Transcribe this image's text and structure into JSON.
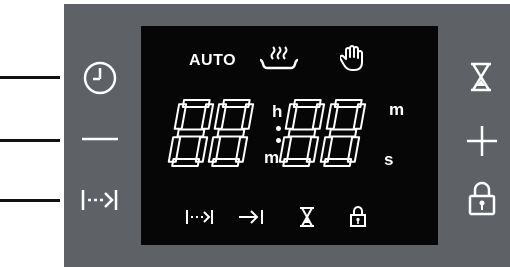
{
  "callout_lines": [
    "clock",
    "minus",
    "cooking-time"
  ],
  "controls_left": [
    {
      "id": "clock",
      "icon": "clock-icon"
    },
    {
      "id": "minus",
      "icon": "minus-icon"
    },
    {
      "id": "cooking-time",
      "icon": "cooking-time-icon"
    }
  ],
  "controls_right": [
    {
      "id": "timer",
      "icon": "hourglass-icon"
    },
    {
      "id": "plus",
      "icon": "plus-icon"
    },
    {
      "id": "lock",
      "icon": "lock-icon"
    }
  ],
  "display": {
    "auto_label": "AUTO",
    "time_digits": [
      "8",
      "8",
      "8",
      "8"
    ],
    "unit_h": "h",
    "unit_m_left": "m",
    "unit_m_right": "m",
    "unit_s": "s",
    "top_indicators": [
      "heating-icon",
      "hand-icon"
    ],
    "bottom_indicators": [
      "cooking-time-icon",
      "end-time-icon",
      "hourglass-icon",
      "lock-icon"
    ]
  },
  "colors": {
    "panel": "#5e6166",
    "display_bg": "#060606",
    "display_fg": "#ffffff",
    "icon_light": "#ffffff"
  }
}
